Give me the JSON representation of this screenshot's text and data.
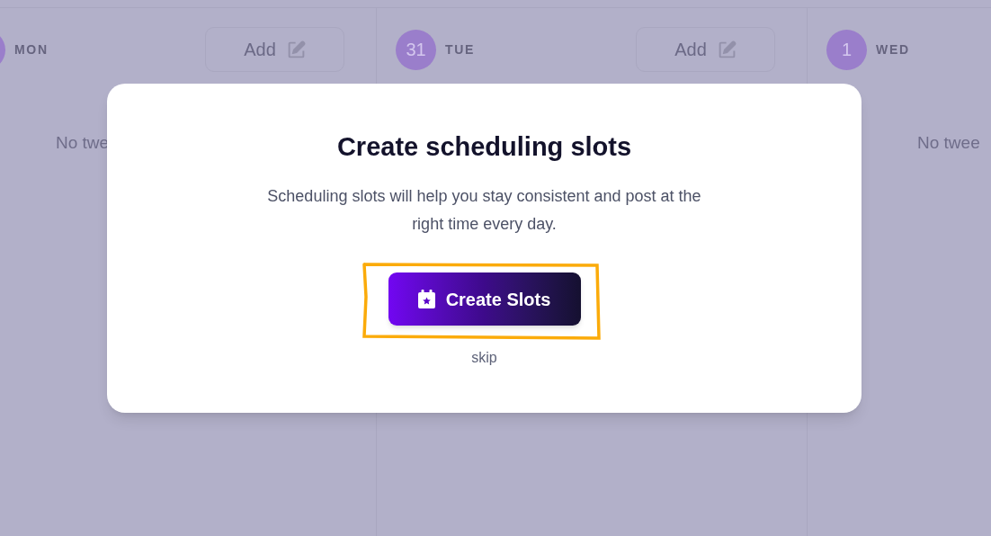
{
  "calendar": {
    "columns": [
      {
        "day": "MON",
        "add_label": "Add",
        "empty_text": "No twe"
      },
      {
        "date": "31",
        "day": "TUE",
        "add_label": "Add"
      },
      {
        "date": "1",
        "day": "WED",
        "empty_text": "No twee"
      }
    ]
  },
  "modal": {
    "title": "Create scheduling slots",
    "description": "Scheduling slots will help you stay consistent and post at the right time every day.",
    "primary_button": "Create Slots",
    "skip_link": "skip"
  }
}
